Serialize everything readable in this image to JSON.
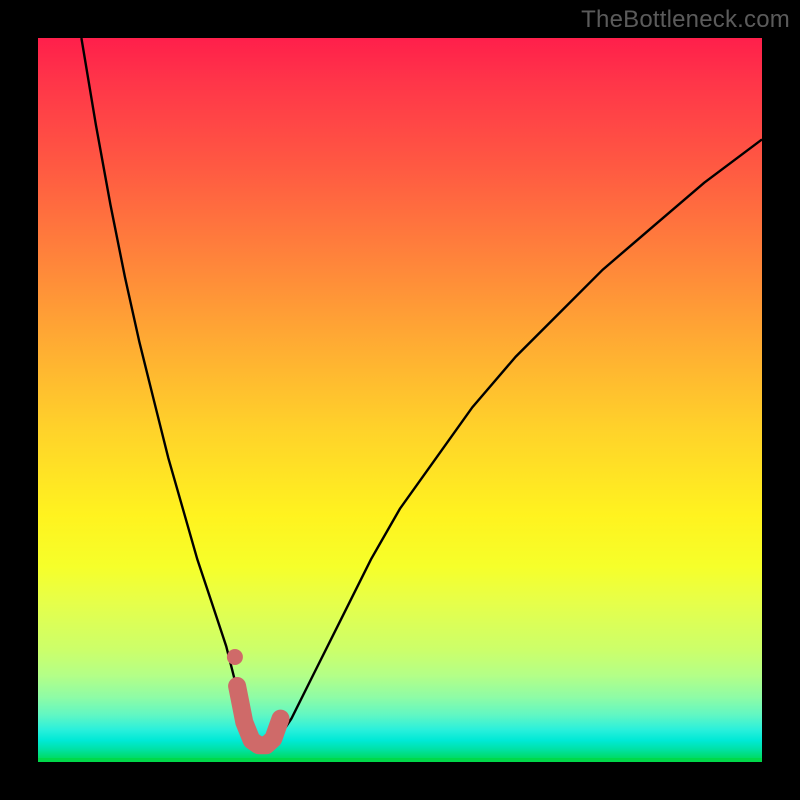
{
  "watermark": "TheBottleneck.com",
  "colors": {
    "frame": "#000000",
    "curve": "#000000",
    "marker": "#cf6a69",
    "gradient_top": "#ff1f4b",
    "gradient_mid": "#fff31f",
    "gradient_bottom": "#00d94b"
  },
  "chart_data": {
    "type": "line",
    "title": "",
    "xlabel": "",
    "ylabel": "",
    "xlim": [
      0,
      100
    ],
    "ylim": [
      0,
      100
    ],
    "grid": false,
    "legend": false,
    "annotations": [],
    "series": [
      {
        "name": "bottleneck-curve",
        "x": [
          6,
          8,
          10,
          12,
          14,
          16,
          18,
          20,
          22,
          24,
          26,
          27,
          28,
          29,
          30,
          31,
          32,
          33,
          35,
          38,
          42,
          46,
          50,
          55,
          60,
          66,
          72,
          78,
          85,
          92,
          100
        ],
        "y": [
          100,
          88,
          77,
          67,
          58,
          50,
          42,
          35,
          28,
          22,
          16,
          12,
          8,
          5,
          3,
          2,
          2,
          3,
          6,
          12,
          20,
          28,
          35,
          42,
          49,
          56,
          62,
          68,
          74,
          80,
          86
        ]
      }
    ],
    "markers": {
      "name": "bottleneck-minimum-band",
      "shape": "rounded",
      "color": "#cf6a69",
      "points_x": [
        27.5,
        28.5,
        29.5,
        30.5,
        31.5,
        32.5,
        33.5
      ],
      "points_y": [
        10.5,
        5.5,
        3,
        2.3,
        2.3,
        3.2,
        6
      ],
      "extra_dot": {
        "x": 27.2,
        "y": 14.5
      }
    }
  }
}
